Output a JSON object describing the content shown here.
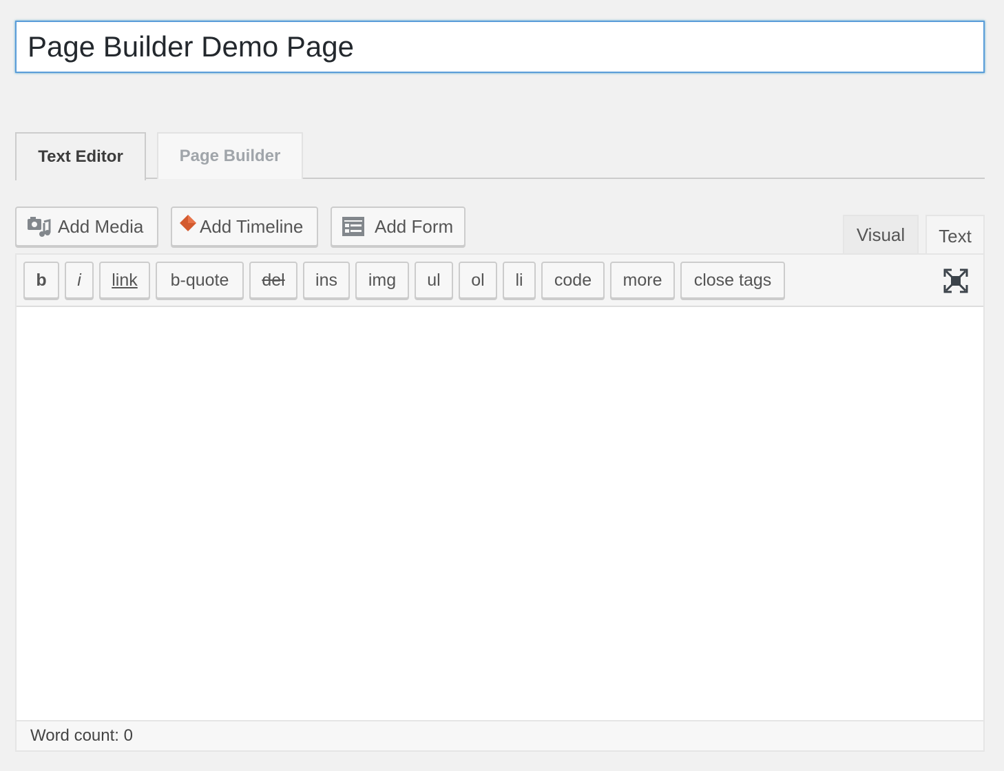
{
  "post_title": "Page Builder Demo Page",
  "builder_tabs": [
    {
      "label": "Text Editor",
      "active": true
    },
    {
      "label": "Page Builder",
      "active": false
    }
  ],
  "media_buttons": {
    "add_media": {
      "label": "Add Media",
      "icon": "media-icon"
    },
    "add_timeline": {
      "label": "Add Timeline",
      "icon": "timeline-diamond-icon",
      "icon_color": "#d35a2e"
    },
    "add_form": {
      "label": "Add Form",
      "icon": "form-icon"
    }
  },
  "mode_tabs": {
    "visual": "Visual",
    "text": "Text",
    "active": "text"
  },
  "quicktags": [
    "b",
    "i",
    "link",
    "b-quote",
    "del",
    "ins",
    "img",
    "ul",
    "ol",
    "li",
    "code",
    "more",
    "close tags"
  ],
  "fullscreen_icon": "fullscreen-icon",
  "editor_content": "",
  "status": {
    "word_count_label": "Word count: 0"
  }
}
